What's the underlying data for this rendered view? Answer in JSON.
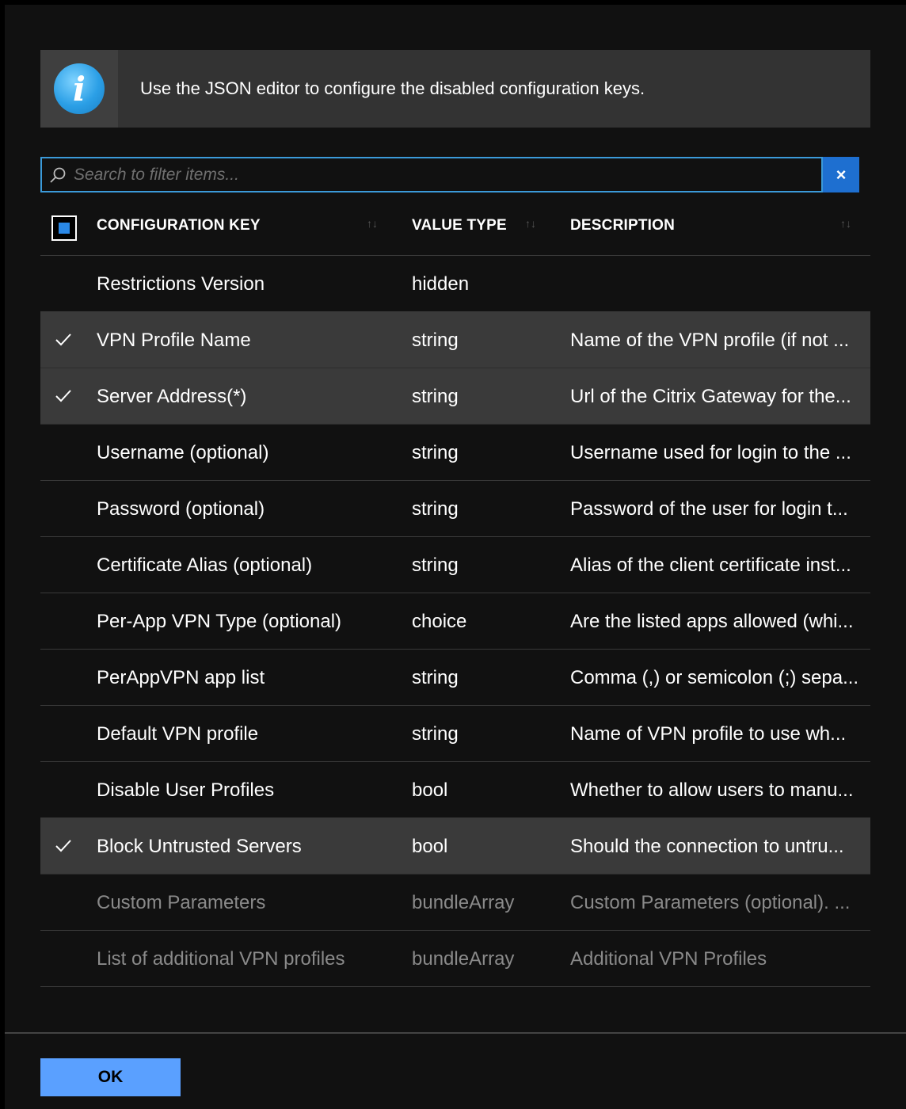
{
  "banner": {
    "icon": "info-icon",
    "icon_glyph": "i",
    "message": "Use the JSON editor to configure the disabled configuration keys."
  },
  "search": {
    "placeholder": "Search to filter items...",
    "value": "",
    "clear_label": "×"
  },
  "table": {
    "columns": [
      {
        "label": "CONFIGURATION KEY",
        "sortable": true
      },
      {
        "label": "VALUE TYPE",
        "sortable": true
      },
      {
        "label": "DESCRIPTION",
        "sortable": true
      }
    ],
    "select_all_state": "indeterminate",
    "rows": [
      {
        "key": "Restrictions Version",
        "type": "hidden",
        "description": "",
        "selected": false,
        "disabled": false
      },
      {
        "key": "VPN Profile Name",
        "type": "string",
        "description": "Name of the VPN profile (if not ...",
        "selected": true,
        "disabled": false
      },
      {
        "key": "Server Address(*)",
        "type": "string",
        "description": "Url of the Citrix Gateway for the...",
        "selected": true,
        "disabled": false
      },
      {
        "key": "Username (optional)",
        "type": "string",
        "description": "Username used for login to the ...",
        "selected": false,
        "disabled": false
      },
      {
        "key": "Password (optional)",
        "type": "string",
        "description": "Password of the user for login t...",
        "selected": false,
        "disabled": false
      },
      {
        "key": "Certificate Alias (optional)",
        "type": "string",
        "description": "Alias of the client certificate inst...",
        "selected": false,
        "disabled": false
      },
      {
        "key": "Per-App VPN Type (optional)",
        "type": "choice",
        "description": "Are the listed apps allowed (whi...",
        "selected": false,
        "disabled": false
      },
      {
        "key": "PerAppVPN app list",
        "type": "string",
        "description": "Comma (,) or semicolon (;) sepa...",
        "selected": false,
        "disabled": false
      },
      {
        "key": "Default VPN profile",
        "type": "string",
        "description": "Name of VPN profile to use wh...",
        "selected": false,
        "disabled": false
      },
      {
        "key": "Disable User Profiles",
        "type": "bool",
        "description": "Whether to allow users to manu...",
        "selected": false,
        "disabled": false
      },
      {
        "key": "Block Untrusted Servers",
        "type": "bool",
        "description": "Should the connection to untru...",
        "selected": true,
        "disabled": false
      },
      {
        "key": "Custom Parameters",
        "type": "bundleArray",
        "description": "Custom Parameters (optional). ...",
        "selected": false,
        "disabled": true
      },
      {
        "key": "List of additional VPN profiles",
        "type": "bundleArray",
        "description": "Additional VPN Profiles",
        "selected": false,
        "disabled": true
      }
    ]
  },
  "footer": {
    "ok_label": "OK"
  },
  "colors": {
    "accent": "#2a88e6",
    "ok_button": "#5aa0ff",
    "selected_row": "#3a3a3a",
    "search_border": "#3b9ad9"
  }
}
